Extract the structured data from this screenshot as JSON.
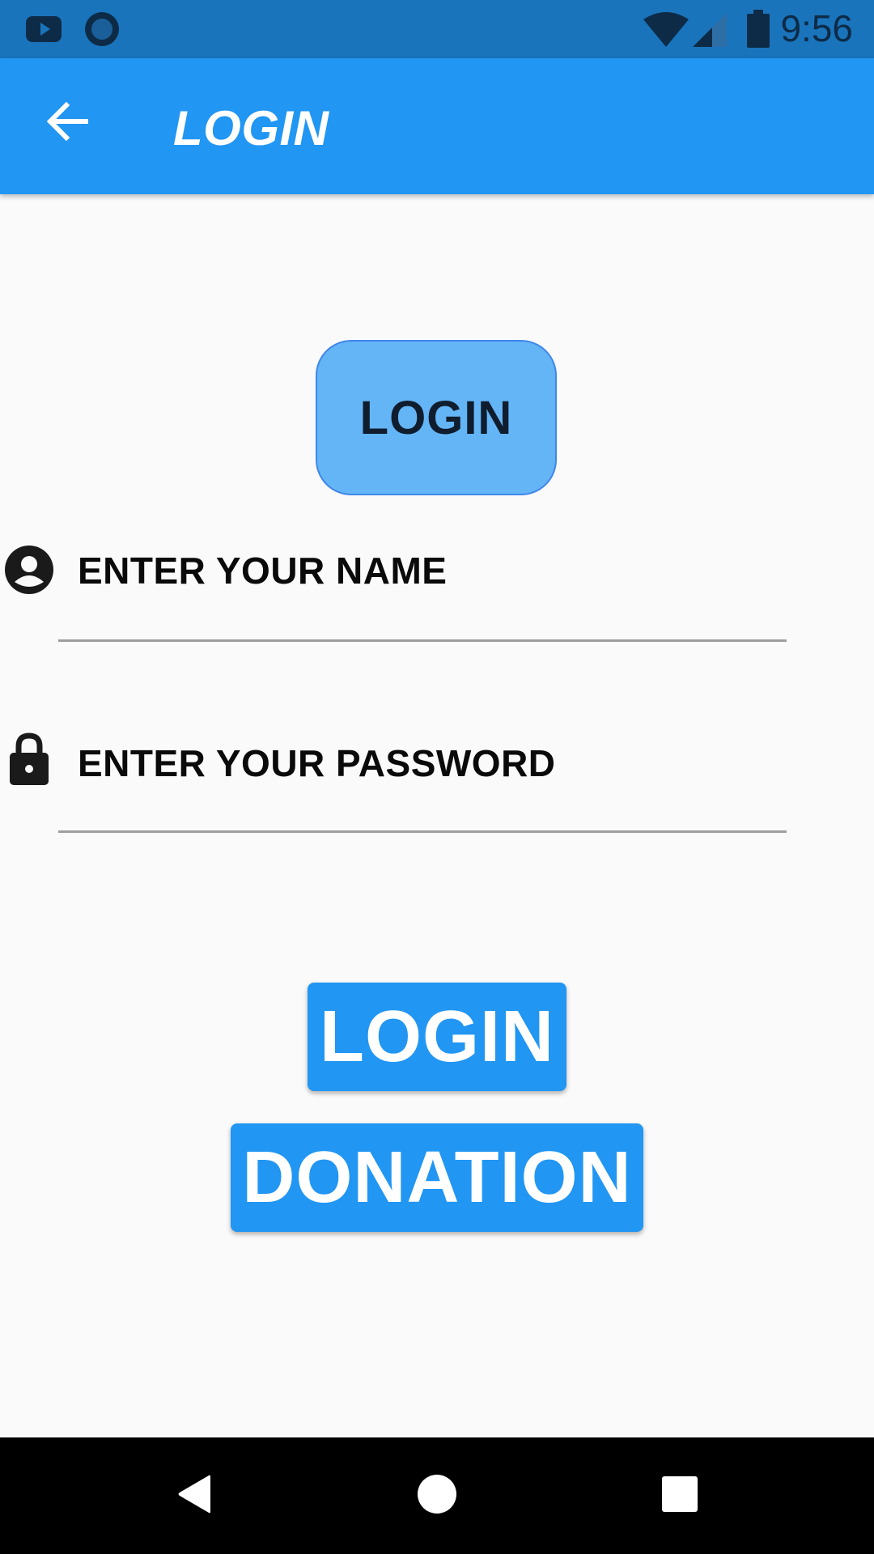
{
  "status_bar": {
    "time": "9:56",
    "icons": [
      "youtube-icon",
      "circle-notification-icon",
      "wifi-icon",
      "signal-icon",
      "battery-icon"
    ]
  },
  "app_bar": {
    "title": "LOGIN",
    "back_icon": "arrow-back-icon"
  },
  "header": {
    "badge_label": "LOGIN"
  },
  "form": {
    "name_field": {
      "placeholder": "ENTER YOUR NAME",
      "value": "",
      "icon": "account-circle-icon"
    },
    "password_field": {
      "placeholder": "ENTER YOUR PASSWORD",
      "value": "",
      "icon": "lock-icon"
    }
  },
  "buttons": {
    "login_label": "LOGIN",
    "donation_label": "DONATION"
  },
  "nav_bar": {
    "icons": [
      "back-triangle-icon",
      "home-circle-icon",
      "recents-square-icon"
    ]
  },
  "colors": {
    "status_bar": "#1a74bc",
    "primary": "#2196f3",
    "badge": "#64b5f6",
    "background": "#fafafa"
  }
}
